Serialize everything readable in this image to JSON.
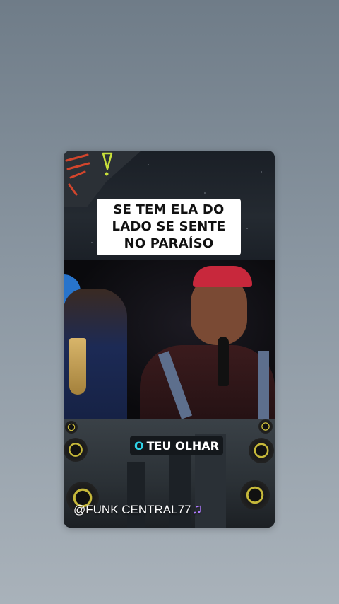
{
  "video": {
    "caption_top": [
      "SE TEM ELA DO",
      "LADO SE SENTE",
      "NO PARAÍSO"
    ],
    "caption_bottom": {
      "highlight": "O",
      "rest": "TEU OLHAR"
    },
    "watermark": {
      "text": "@FUNK CENTRAL77",
      "icon": "music-note-icon",
      "icon_glyph": "♫"
    }
  },
  "colors": {
    "background_top": "#6f7c88",
    "background_bottom": "#a9b2ba",
    "caption_highlight": "#2fd4e8",
    "note_icon": "#b07cff",
    "cap": "#c8283c"
  }
}
